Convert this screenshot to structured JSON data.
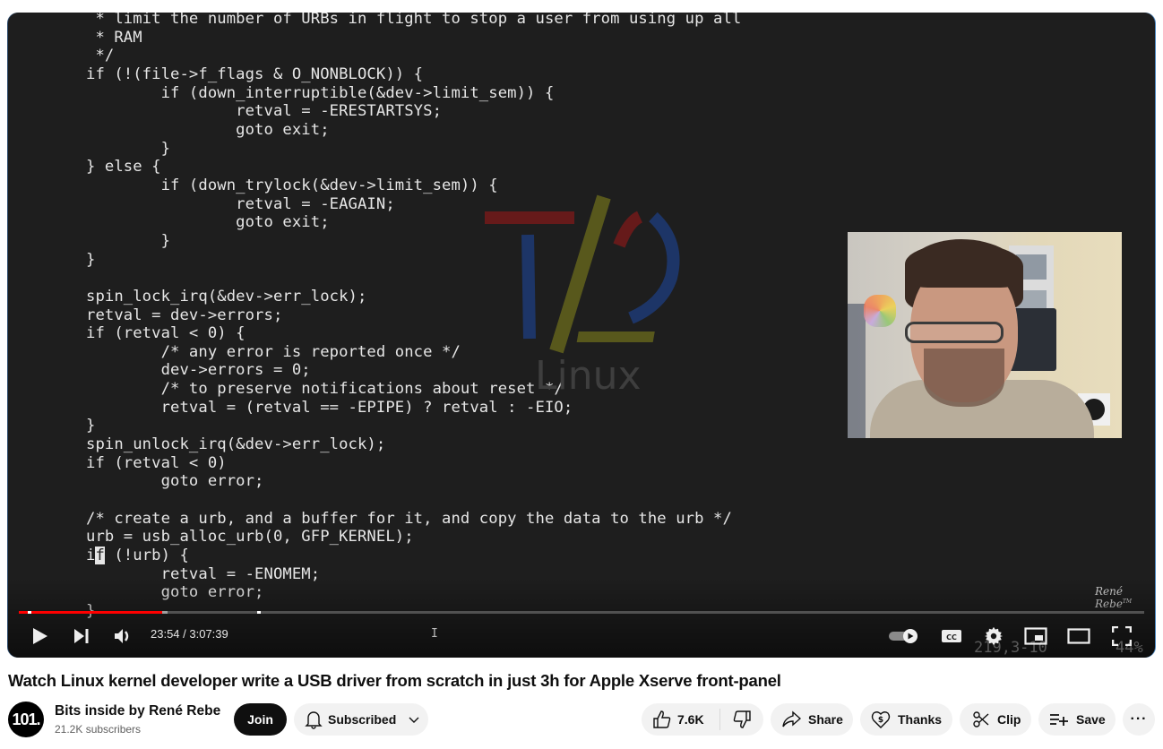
{
  "player": {
    "code_lines": [
      "\t * limit the number of URBs in flight to stop a user from using up all",
      "\t * RAM",
      "\t */",
      "\tif (!(file->f_flags & O_NONBLOCK)) {",
      "\t\tif (down_interruptible(&dev->limit_sem)) {",
      "\t\t\tretval = -ERESTARTSYS;",
      "\t\t\tgoto exit;",
      "\t\t}",
      "\t} else {",
      "\t\tif (down_trylock(&dev->limit_sem)) {",
      "\t\t\tretval = -EAGAIN;",
      "\t\t\tgoto exit;",
      "\t\t}",
      "\t}",
      "",
      "\tspin_lock_irq(&dev->err_lock);",
      "\tretval = dev->errors;",
      "\tif (retval < 0) {",
      "\t\t/* any error is reported once */",
      "\t\tdev->errors = 0;",
      "\t\t/* to preserve notifications about reset */",
      "\t\tretval = (retval == -EPIPE) ? retval : -EIO;",
      "\t}",
      "\tspin_unlock_irq(&dev->err_lock);",
      "\tif (retval < 0)",
      "\t\tgoto error;",
      "",
      "\t/* create a urb, and a buffer for it, and copy the data to the urb */",
      "\turb = usb_alloc_urb(0, GFP_KERNEL);",
      "\tif (!urb) {",
      "\t\tretval = -ENOMEM;",
      "\t\tgoto error;",
      "\t}"
    ],
    "cursor_line": 29,
    "cursor_col": 2,
    "logo_text": "Linux",
    "watermark": "René Rebe",
    "watermark_tm": "TM",
    "vim_status": "219,3-10",
    "vim_percent": "44%",
    "progress": {
      "current_time": "23:54",
      "duration": "3:07:39",
      "time_label": "23:54 / 3:07:39",
      "played_fraction": 0.1274,
      "loaded_fraction": 0.1322,
      "chapter_marker_fractions": [
        0.008,
        0.2114
      ]
    },
    "controls": {
      "play": "play-icon",
      "next": "next-icon",
      "volume": "volume-icon",
      "autoplay": "autoplay-toggle-icon",
      "captions": "CC",
      "settings": "gear-icon",
      "miniplayer": "miniplayer-icon",
      "theater": "theater-mode-icon",
      "fullscreen": "fullscreen-icon"
    },
    "ibeam": "I"
  },
  "video": {
    "title": "Watch Linux kernel developer write a USB driver from scratch in just 3h for Apple Xserve front-panel"
  },
  "channel": {
    "avatar_text": "101.",
    "name": "Bits inside by René Rebe",
    "subscribers": "21.2K subscribers",
    "join_label": "Join",
    "subscribed_label": "Subscribed"
  },
  "actions": {
    "likes": "7.6K",
    "share_label": "Share",
    "thanks_label": "Thanks",
    "clip_label": "Clip",
    "save_label": "Save",
    "more_label": "···"
  },
  "colors": {
    "progress_played": "#ff0000",
    "player_bg": "#1e1e1e",
    "logo_red": "#7a1a1a",
    "logo_blue": "#1d3a72",
    "logo_yellow": "#6b6a1e"
  }
}
